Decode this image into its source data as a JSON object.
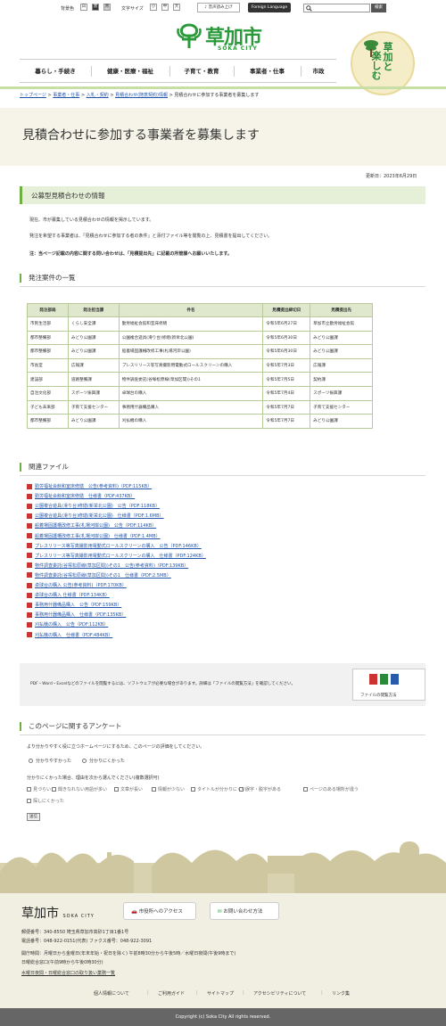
{
  "topbar": {
    "bg_label": "背景色",
    "bg_options": [
      "白",
      "黒",
      "青"
    ],
    "text_label": "文字サイズ",
    "size_options": [
      "小",
      "中",
      "大"
    ],
    "voice": "音声読み上げ",
    "foreign": "Foreign Language",
    "search_placeholder": "",
    "search_button": "検索"
  },
  "header": {
    "logo_jp": "草加市",
    "logo_en": "SOKA CITY",
    "emblem_text_1": "草加と",
    "emblem_text_2": "楽しむ"
  },
  "nav": [
    "暮らし・手続き",
    "健康・医療・福祉",
    "子育て・教育",
    "事業者・仕事",
    "市政"
  ],
  "breadcrumb": {
    "items": [
      "トップページ",
      "事業者・仕事",
      "入札・契約",
      "見積合わせ(随意契約)情報"
    ],
    "current": "見積合わせに参加する事業者を募集します",
    "sep": ">"
  },
  "page": {
    "title": "見積合わせに参加する事業者を募集します",
    "updated": "更新日：2023年6月29日"
  },
  "info": {
    "heading": "公募型見積合わせの情報",
    "p1": "現在、市が募集している見積合わせの情報を掲示しています。",
    "p2": "発注を希望する事業者は、「見積合わせに参加する者の条件」と添付ファイル等を閲覧の上、見積書を提出してください。",
    "note": "注：当ページ記載の内容に関する問い合わせは、「見積提出先」に記載の所管課へお願いいたします。"
  },
  "orders": {
    "heading": "発注案件の一覧",
    "columns": [
      "発注部局",
      "発注担当課",
      "件名",
      "見積提出締切日",
      "見積提出先"
    ],
    "rows": [
      [
        "市民生活部",
        "くらし安全課",
        "勤労福祉会館和室床修繕",
        "令和5年6月27日",
        "草加市立勤労福祉会館"
      ],
      [
        "都市整備部",
        "みどり公園課",
        "公園複合遊具(滑り台)修繕(新栄北公園)",
        "令和5年6月30日",
        "みどり公園課"
      ],
      [
        "都市整備部",
        "みどり公園課",
        "船着場固護柵改修工事(札場河岸公園)",
        "令和5年6月30日",
        "みどり公園課"
      ],
      [
        "市長室",
        "広報課",
        "プレスリリース等写真撮影用電動式ロールスクリーンの購入",
        "令和5年7月3日",
        "広報課"
      ],
      [
        "建設部",
        "道路整備課",
        "物件調査委託(谷塚松原線(草加区間))その1",
        "令和5年7月5日",
        "契約課"
      ],
      [
        "自治文化部",
        "スポーツ振興課",
        "卓球台の購入",
        "令和5年7月4日",
        "スポーツ振興課"
      ],
      [
        "子ども未来部",
        "子育て支援センター",
        "事務用什器備品購入",
        "令和5年7月7日",
        "子育て支援センター"
      ],
      [
        "都市整備部",
        "みどり公園課",
        "刈払機の購入",
        "令和5年7月7日",
        "みどり公園課"
      ]
    ]
  },
  "files": {
    "heading": "関連ファイル",
    "items": [
      "勤労福祉会館和室床修繕　公告(参考資料)（PDF:115KB）",
      "勤労福祉会館和室床修繕　仕様書（PDF:437KB）",
      "公園複合遊具(滑り台)修繕(新栄北公園)　公告（PDF:118KB）",
      "公園複合遊具(滑り台)修繕(新栄北公園)　仕様書（PDF:1.6MB）",
      "船着場固護柵改修工事(札場河岸公園)　公告（PDF:114KB）",
      "船着場固護柵改修工事(札場河岸公園)　仕様書（PDF:1.4MB）",
      "プレスリリース等写真撮影用電動式ロールスクリーンの購入　公告（PDF:146KB）",
      "プレスリリース等写真撮影用電動式ロールスクリーンの購入　仕様書（PDF:124KB）",
      "物件調査委託(谷塚松原線(草加区間))その1　公告(参考資料)（PDF:139KB）",
      "物件調査委託(谷塚松原線(草加区間))その1　仕様書（PDF:2.5MB）",
      "卓球台の購入 公告(参考資料)（PDF:170KB）",
      "卓球台の購入 仕様書（PDF:134KB）",
      "事務用什器備品購入　公告（PDF:159KB）",
      "事務用什器備品購入　仕様書（PDF:135KB）",
      "刈払機の購入　公告（PDF:112KB）",
      "刈払機の購入　仕様書（PDF:484KB）"
    ]
  },
  "plugin": {
    "message": "PDF・Word・Excelなどのファイルを閲覧するには、ソフトウェアが必要な場合があります。詳細は「ファイルの閲覧方法」を確認してください。",
    "card_label": "ファイルの閲覧方法"
  },
  "survey": {
    "heading": "このページに関するアンケート",
    "q1": "より分かりやすく役に立つホームページにするため、このページの評価をしてください。",
    "q1_options": [
      "分かりやすかった",
      "分かりにくかった"
    ],
    "q2": "分かりにくかった場合、理由を次から選んでください(複数選択可)",
    "q2_options": [
      "見づらい",
      "聞きなれない用語が多い",
      "文章が長い",
      "情報が少ない",
      "タイトルが分かりにくい",
      "誤字・脱字がある",
      "ページのある場所が違う",
      "探しにくかった"
    ],
    "send": "送信"
  },
  "footer": {
    "logo_jp": "草加市",
    "logo_en": "SOKA CITY",
    "access": "市役所へのアクセス",
    "contact": "お問い合わせ方法",
    "address": "郵便番号：340-8550 埼玉県草加市高砂1丁目1番1号",
    "phone": "電話番号：048-922-0151(代表)  ファクス番号：048-922-3091",
    "hours1": "開庁時間：月曜日から金曜日(年末年始・祝日を除く) 午前8時30分から午後5時／水曜日夜間(午後9時まで)",
    "hours2": "日曜総合窓口(午前9時から午後0時30分)",
    "hours_link": "水曜日夜間・日曜総合窓口の取り扱い業務一覧",
    "links": [
      "個人情報について",
      "ご利用ガイド",
      "サイトマップ",
      "アクセシビリティについて",
      "リンク集"
    ],
    "copyright": "Copyright (c) Soka City All rights reserved."
  },
  "colors": {
    "accent_green": "#6fb045",
    "logo_green": "#2a9a3a",
    "table_header": "#dfe8cc",
    "footer_bg": "#f1efe2"
  }
}
